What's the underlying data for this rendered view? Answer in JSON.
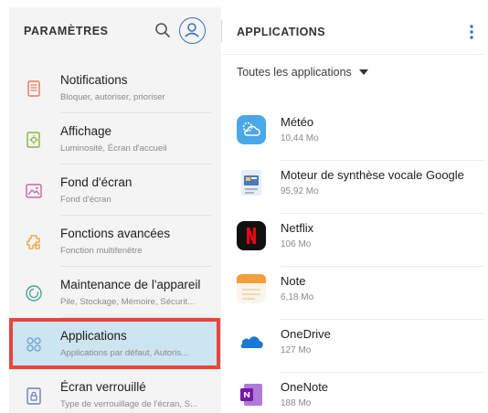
{
  "left_panel": {
    "title": "PARAMÈTRES",
    "items": [
      {
        "label": "Notifications",
        "sub": "Bloquer, autoriser, prioriser",
        "icon": "notifications-icon"
      },
      {
        "label": "Affichage",
        "sub": "Luminosité, Écran d'accueil",
        "icon": "display-icon"
      },
      {
        "label": "Fond d'écran",
        "sub": "Fond d'écran",
        "icon": "wallpaper-icon"
      },
      {
        "label": "Fonctions avancées",
        "sub": "Fonction multifenêtre",
        "icon": "advanced-features-icon"
      },
      {
        "label": "Maintenance de l'appareil",
        "sub": "Pile, Stockage, Mémoire, Sécurit...",
        "icon": "device-maintenance-icon"
      },
      {
        "label": "Applications",
        "sub": "Applications par défaut, Autoris...",
        "icon": "applications-icon",
        "selected": true
      },
      {
        "label": "Écran verrouillé",
        "sub": "Type de verrouillage de l'écran, S...",
        "icon": "lock-screen-icon"
      }
    ]
  },
  "right_panel": {
    "title": "APPLICATIONS",
    "filter_label": "Toutes les applications",
    "apps": [
      {
        "name": "Météo",
        "size": "10,44 Mo",
        "icon": "weather-app-icon"
      },
      {
        "name": "Moteur de synthèse vocale Google",
        "size": "95,92 Mo",
        "icon": "google-tts-icon"
      },
      {
        "name": "Netflix",
        "size": "106 Mo",
        "icon": "netflix-icon"
      },
      {
        "name": "Note",
        "size": "6,18 Mo",
        "icon": "note-app-icon"
      },
      {
        "name": "OneDrive",
        "size": "127 Mo",
        "icon": "onedrive-icon"
      },
      {
        "name": "OneNote",
        "size": "188 Mo",
        "icon": "onenote-icon"
      }
    ]
  },
  "colors": {
    "selected_bg": "#cde4f1",
    "highlight_border": "#e8453c",
    "accent": "#3d6ec4"
  }
}
